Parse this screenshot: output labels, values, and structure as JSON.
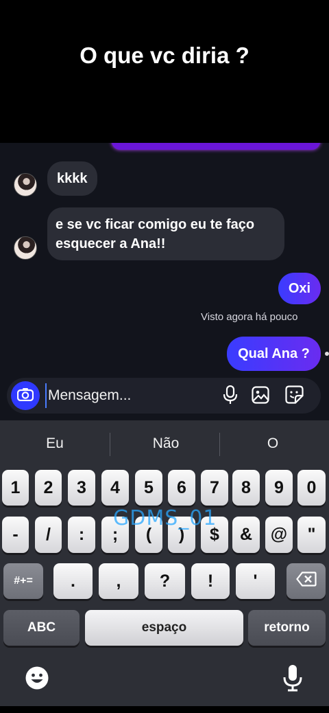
{
  "caption": "O que vc diria ?",
  "messages": [
    {
      "from": "them",
      "text": "kkkk"
    },
    {
      "from": "them",
      "text_line1": "e se vc ficar comigo eu te faço",
      "text_line2": "esquecer a Ana!!"
    },
    {
      "from": "me",
      "text": "Oxi"
    },
    {
      "from": "me",
      "text": "Qual Ana ?"
    }
  ],
  "seen_status": "Visto agora há pouco",
  "composer": {
    "placeholder": "Mensagem...",
    "camera_icon": "camera-icon",
    "mic_icon": "microphone-icon",
    "gallery_icon": "gallery-icon",
    "sticker_icon": "sticker-icon"
  },
  "keyboard": {
    "suggestions": [
      "Eu",
      "Não",
      "O"
    ],
    "row1": [
      "1",
      "2",
      "3",
      "4",
      "5",
      "6",
      "7",
      "8",
      "9",
      "0"
    ],
    "row2": [
      "-",
      "/",
      ":",
      ";",
      "(",
      ")",
      "$",
      "&",
      "@",
      "\""
    ],
    "row3": [
      "#+=",
      ".",
      ",",
      "?",
      "!",
      "'"
    ],
    "abc_label": "ABC",
    "space_label": "espaço",
    "return_label": "retorno",
    "watermark": "GDMS_01",
    "backspace_icon": "backspace-icon",
    "emoji_icon": "emoji-icon",
    "dictation_icon": "microphone-icon"
  },
  "colors": {
    "outgoing_bubble": "#3a3cff",
    "incoming_bubble": "#2b2d36",
    "camera_button": "#2f39ff"
  }
}
